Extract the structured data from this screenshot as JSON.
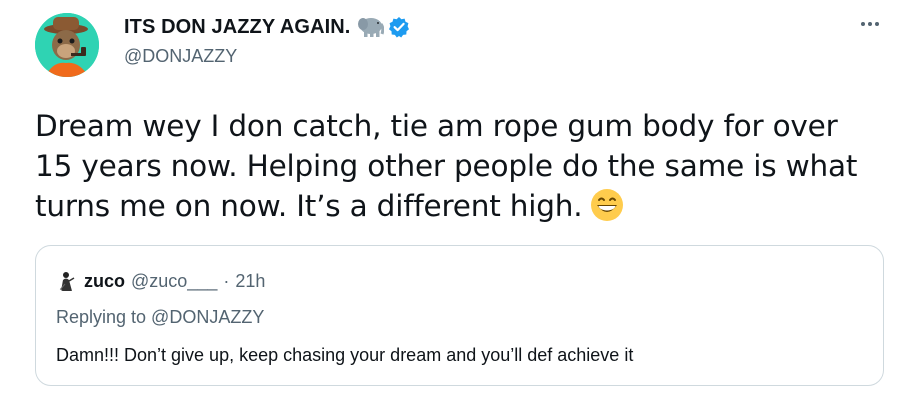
{
  "author": {
    "display_name": "ITS DON JAZZY AGAIN.",
    "handle": "@DONJAZZY",
    "badge_emoji": "elephant-emoji",
    "verified": true
  },
  "tweet": {
    "text": "Dream wey I don catch, tie am rope gum body for over 15 years now. Helping other people do the same is what turns me on now. It’s a different high.",
    "trailing_emoji": "grinning-face-with-smiling-eyes"
  },
  "quoted_tweet": {
    "name": "zuco",
    "handle": "@zuco___",
    "separator": "·",
    "time": "21h",
    "replying_to": "Replying to @DONJAZZY",
    "text": "Damn!!!  Don’t give up, keep chasing your dream and you’ll def achieve it"
  },
  "colors": {
    "text_primary": "#0f1419",
    "text_secondary": "#536471",
    "verified_blue": "#1d9bf0",
    "border": "#cfd9de",
    "avatar_bg": "#2fd3b3"
  }
}
